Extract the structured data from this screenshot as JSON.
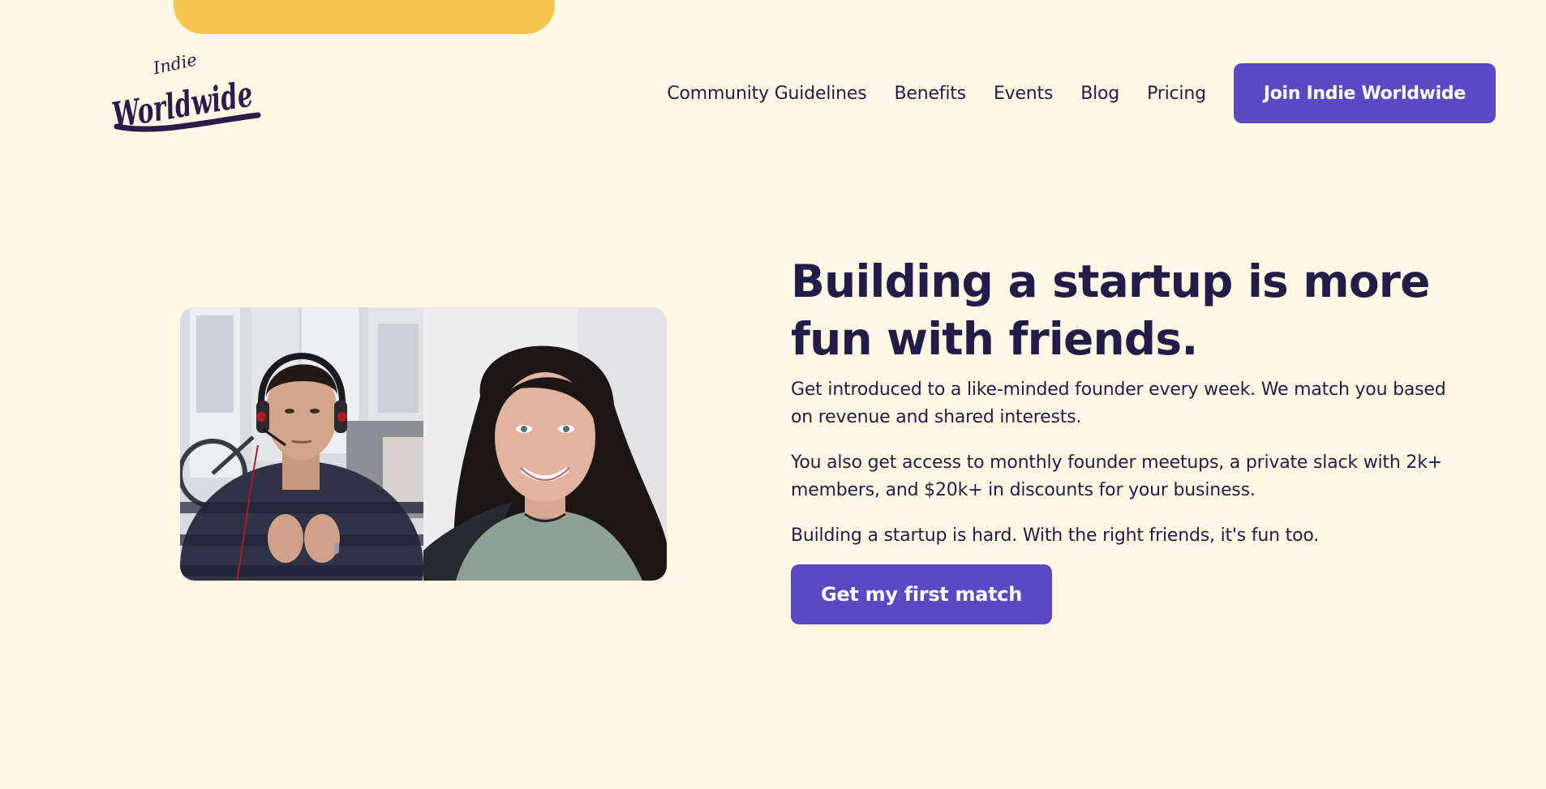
{
  "brand": {
    "logo_small_text": "Indie",
    "logo_main_text": "Worldwide",
    "logo_alt": "Indie Worldwide"
  },
  "nav": {
    "links": [
      {
        "label": "Community Guidelines"
      },
      {
        "label": "Benefits"
      },
      {
        "label": "Events"
      },
      {
        "label": "Blog"
      },
      {
        "label": "Pricing"
      }
    ],
    "join_label": "Join Indie Worldwide"
  },
  "hero": {
    "headline": "Building a startup is more fun with friends.",
    "paragraphs": [
      "Get introduced to a like-minded founder every week. We match you based on revenue and shared interests.",
      "You also get access to monthly founder meetups, a private slack with 2k+ members, and $20k+ in discounts for your business.",
      "Building a startup is hard. With the right friends, it's fun too."
    ],
    "cta_label": "Get my first match"
  },
  "colors": {
    "background": "#FEF7E4",
    "accent_purple": "#5A49C2",
    "accent_yellow": "#F6C54E",
    "text_dark": "#211D48"
  }
}
